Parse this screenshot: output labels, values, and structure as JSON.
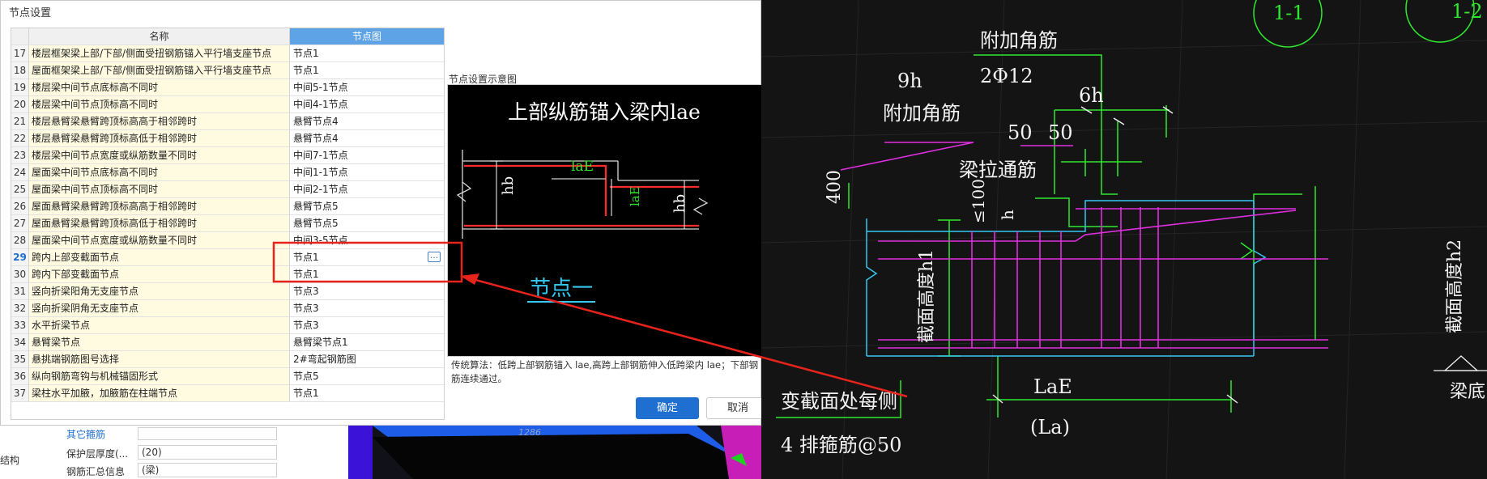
{
  "dialog": {
    "title": "节点设置",
    "columns": {
      "name": "名称",
      "node": "节点图"
    },
    "rows": [
      {
        "num": "17",
        "name": "楼层框架梁上部/下部/侧面受扭钢筋锚入平行墙支座节点",
        "node": "节点1"
      },
      {
        "num": "18",
        "name": "屋面框架梁上部/下部/侧面受扭钢筋锚入平行墙支座节点",
        "node": "节点1"
      },
      {
        "num": "19",
        "name": "楼层梁中间节点底标高不同时",
        "node": "中间5-1节点"
      },
      {
        "num": "20",
        "name": "楼层梁中间节点顶标高不同时",
        "node": "中间4-1节点"
      },
      {
        "num": "21",
        "name": "楼层悬臂梁悬臂跨顶标高高于相邻跨时",
        "node": "悬臂节点4"
      },
      {
        "num": "22",
        "name": "楼层悬臂梁悬臂跨顶标高低于相邻跨时",
        "node": "悬臂节点4"
      },
      {
        "num": "23",
        "name": "楼层梁中间节点宽度或纵筋数量不同时",
        "node": "中间7-1节点"
      },
      {
        "num": "24",
        "name": "屋面梁中间节点底标高不同时",
        "node": "中间1-1节点"
      },
      {
        "num": "25",
        "name": "屋面梁中间节点顶标高不同时",
        "node": "中间2-1节点"
      },
      {
        "num": "26",
        "name": "屋面悬臂梁悬臂跨顶标高高于相邻跨时",
        "node": "悬臂节点5"
      },
      {
        "num": "27",
        "name": "屋面悬臂梁悬臂跨顶标高低于相邻跨时",
        "node": "悬臂节点5"
      },
      {
        "num": "28",
        "name": "屋面梁中间节点宽度或纵筋数量不同时",
        "node": "中间3-5节点"
      },
      {
        "num": "29",
        "name": "跨内上部变截面节点",
        "node": "节点1"
      },
      {
        "num": "30",
        "name": "跨内下部变截面节点",
        "node": "节点1"
      },
      {
        "num": "31",
        "name": "竖向折梁阳角无支座节点",
        "node": "节点3"
      },
      {
        "num": "32",
        "name": "竖向折梁阴角无支座节点",
        "node": "节点3"
      },
      {
        "num": "33",
        "name": "水平折梁节点",
        "node": "节点3"
      },
      {
        "num": "34",
        "name": "悬臂梁节点",
        "node": "悬臂梁节点1"
      },
      {
        "num": "35",
        "name": "悬挑端钢筋图号选择",
        "node": "2#弯起钢筋图"
      },
      {
        "num": "36",
        "name": "纵向钢筋弯钩与机械锚固形式",
        "node": "节点5"
      },
      {
        "num": "37",
        "name": "梁柱水平加腋，加腋筋在柱端节点",
        "node": "节点1"
      }
    ],
    "more_button": "…",
    "preview": {
      "label": "节点设置示意图",
      "heading": "上部纵筋锚入梁内lae",
      "dims": {
        "hb": "hb",
        "lae": "laE"
      },
      "caption": "节点一"
    },
    "note": "传统算法：低跨上部钢筋锚入 lae,高跨上部钢筋伸入低跨梁内 lae；下部钢筋连续通过。",
    "ok": "确定",
    "cancel": "取消"
  },
  "bottom": {
    "section": "其它箍筋",
    "side_label": "结构",
    "props": [
      {
        "label": "保护层厚度(...",
        "value": "(20)"
      },
      {
        "label": "钢筋汇总信息",
        "value": "(梁)"
      }
    ],
    "viewport_text": "1286"
  },
  "cad": {
    "labels": {
      "fujia_jiaojin_top": "附加角筋",
      "bar_2phi12": "2Φ12",
      "h9": "9h",
      "fujia_jiaojin_left": "附加角筋",
      "h6": "6h",
      "d50a": "50",
      "d50b": "50",
      "liang_la_tongjin": "梁拉通筋",
      "d400": "400",
      "d100": "≤100",
      "h": "h",
      "jiemian_h1": "截面高度h1",
      "jiemian_h2": "截面高度h2",
      "lae": "LaE",
      "la": "(La)",
      "biangjie_note": "变截面处每侧",
      "gujin": "4 排箍筋@50",
      "liangdi": "梁底",
      "circle_1": "1-1",
      "circle_2": "1-2"
    }
  },
  "colors": {
    "accent": "#1f6fd1",
    "header": "#5ea3e6",
    "callout": "#e8231c",
    "cad_green": "#2ee82e",
    "cad_magenta": "#e02ee0",
    "cad_cyan": "#35c8f0"
  }
}
